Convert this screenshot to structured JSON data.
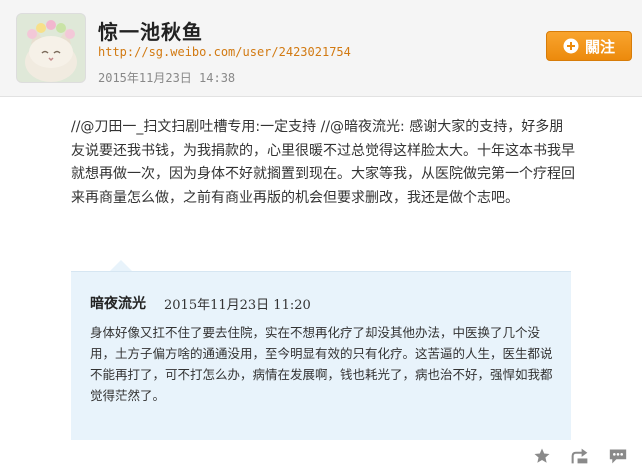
{
  "profile": {
    "name": "惊一池秋鱼",
    "url": "http://sg.weibo.com/user/2423021754",
    "post_time": "2015年11月23日 14:38",
    "avatar": "cat-with-flower-crown"
  },
  "follow_button": {
    "label": "關注",
    "icon": "plus-circle-icon",
    "color": "#f39a1d"
  },
  "post": {
    "text": "//@刀田一_扫文扫剧吐槽专用:一定支持 //@暗夜流光: 感谢大家的支持，好多朋友说要还我书钱，为我捐款的，心里很暖不过总觉得这样脸太大。十年这本书我早就想再做一次，因为身体不好就搁置到现在。大家等我，从医院做完第一个疗程回来再商量怎么做，之前有商业再版的机会但要求删改，我还是做个志吧。"
  },
  "quote": {
    "author": "暗夜流光",
    "time": "2015年11月23日 11:20",
    "text": "身体好像又扛不住了要去住院，实在不想再化疗了却没其他办法，中医换了几个没用，土方子偏方啥的通通没用，至今明显有效的只有化疗。这苦逼的人生，医生都说不能再打了，可不打怎么办，病情在发展啊，钱也耗光了，病也治不好，强悍如我都觉得茫然了。",
    "background": "#e8f3fb"
  },
  "actions": [
    {
      "name": "favorite-star-icon"
    },
    {
      "name": "repost-icon"
    },
    {
      "name": "comment-icon"
    }
  ]
}
